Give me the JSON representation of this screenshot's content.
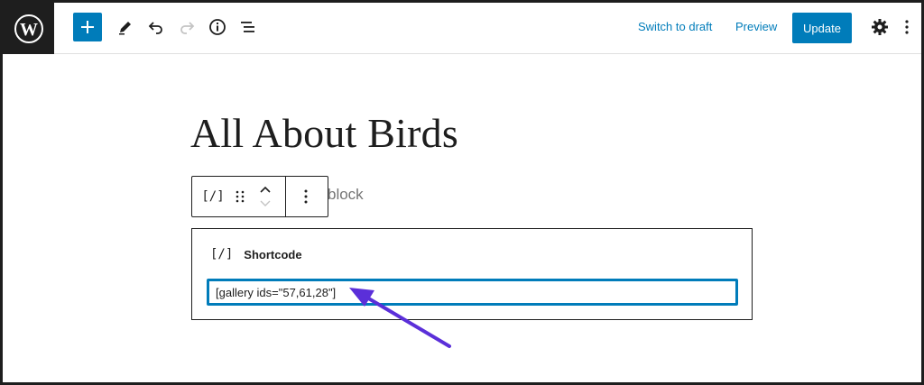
{
  "toolbar": {
    "add_label": "+",
    "switch_to_draft": "Switch to draft",
    "preview": "Preview",
    "update": "Update"
  },
  "icons": {
    "wp_logo": "wordpress-icon",
    "add": "plus-icon",
    "edit": "pencil-icon",
    "undo": "undo-icon",
    "redo": "redo-icon",
    "info": "info-icon",
    "outline": "list-view-icon",
    "settings": "gear-icon",
    "more": "more-vertical-icon"
  },
  "editor": {
    "title": "All About Birds",
    "behind_text": "block",
    "block_toolbar": {
      "icon_text": "[/]"
    },
    "shortcode_block": {
      "icon_text": "[/]",
      "label": "Shortcode",
      "value": "[gallery ids=\"57,61,28\"]"
    }
  },
  "colors": {
    "accent": "#007cba",
    "annotation_arrow": "#5b2fd9"
  }
}
